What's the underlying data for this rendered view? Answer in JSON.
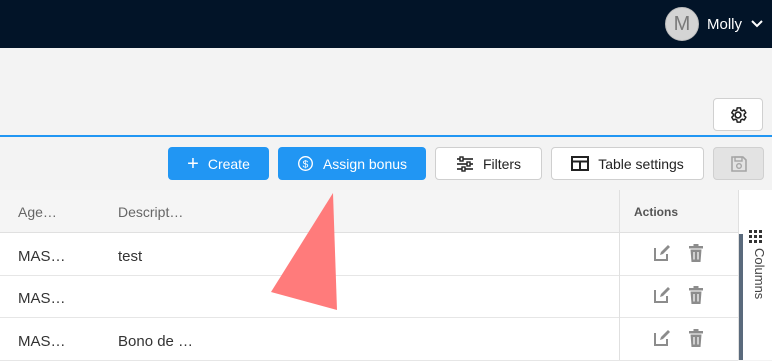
{
  "user": {
    "initial": "M",
    "name": "Molly"
  },
  "toolbar": {
    "create_label": "Create",
    "assign_bonus_label": "Assign bonus",
    "filters_label": "Filters",
    "table_settings_label": "Table settings"
  },
  "table": {
    "columns": [
      "Age…",
      "Descript…",
      "Actions"
    ],
    "rows": [
      {
        "agent": "MAS…",
        "description": "test"
      },
      {
        "agent": "MAS…",
        "description": ""
      },
      {
        "agent": "MAS…",
        "description": "Bono de …"
      }
    ]
  },
  "side_panel": {
    "label": "Columns"
  },
  "colors": {
    "accent": "#2196f3",
    "topbar": "#021428",
    "annotation_arrow": "#ff7b7b"
  }
}
